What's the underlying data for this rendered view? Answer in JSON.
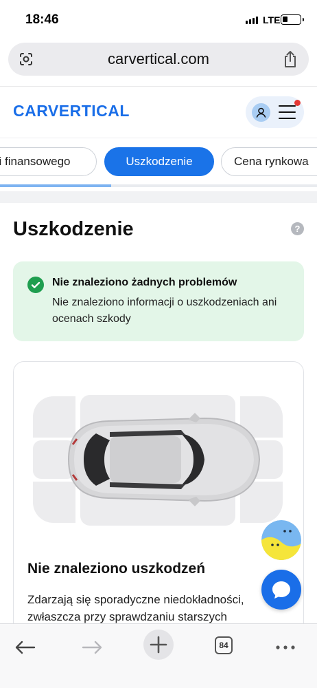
{
  "status_bar": {
    "time": "18:46",
    "network": "LTE",
    "battery_level": 0.25
  },
  "browser": {
    "url": "carvertical.com",
    "lens_icon": "lens-icon",
    "share_icon": "share-icon",
    "open_tabs": "84"
  },
  "header": {
    "logo": "CARVERTICAL",
    "account_icon": "user-icon",
    "menu_icon": "hamburger-icon",
    "colors": {
      "brand": "#1a6ee8",
      "notification": "#e53935"
    }
  },
  "tabs": [
    {
      "label": "i finansowego",
      "active": false
    },
    {
      "label": "Uszkodzenie",
      "active": true
    },
    {
      "label": "Cena rynkowa",
      "active": false
    }
  ],
  "scroll_progress": 0.35,
  "section": {
    "title": "Uszkodzenie",
    "help_icon": "?"
  },
  "status_card": {
    "headline": "Nie znaleziono żadnych problemów",
    "description": "Nie znaleziono informacji o uszkodzeniach ani ocenach szkody",
    "color": "#e3f6e8"
  },
  "damage_card": {
    "title": "Nie znaleziono uszkodzeń",
    "description": "Zdarzają się sporadyczne niedokładności, zwłaszcza przy sprawdzaniu starszych"
  },
  "floating": {
    "bot_icon": "bot-avatar-icon",
    "chat_icon": "chat-bubble-icon"
  }
}
